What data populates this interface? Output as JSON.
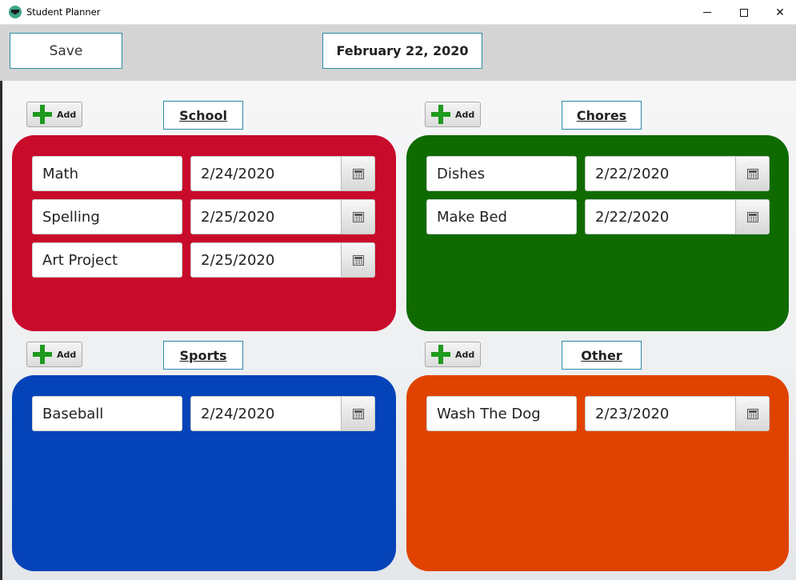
{
  "window": {
    "title": "Student Planner"
  },
  "toolbar": {
    "save_label": "Save",
    "current_date": "February 22, 2020"
  },
  "categories": [
    {
      "name": "School",
      "add_label": "Add",
      "color": "#c80a2b",
      "tasks": [
        {
          "name": "Math",
          "due": "2/24/2020"
        },
        {
          "name": "Spelling",
          "due": "2/25/2020"
        },
        {
          "name": "Art Project",
          "due": "2/25/2020"
        }
      ]
    },
    {
      "name": "Chores",
      "add_label": "Add",
      "color": "#0f6b00",
      "tasks": [
        {
          "name": "Dishes",
          "due": "2/22/2020"
        },
        {
          "name": "Make Bed",
          "due": "2/22/2020"
        }
      ]
    },
    {
      "name": "Sports",
      "add_label": "Add",
      "color": "#0543b9",
      "tasks": [
        {
          "name": "Baseball",
          "due": "2/24/2020"
        }
      ]
    },
    {
      "name": "Other",
      "add_label": "Add",
      "color": "#e04300",
      "tasks": [
        {
          "name": "Wash The Dog",
          "due": "2/23/2020"
        }
      ]
    }
  ]
}
